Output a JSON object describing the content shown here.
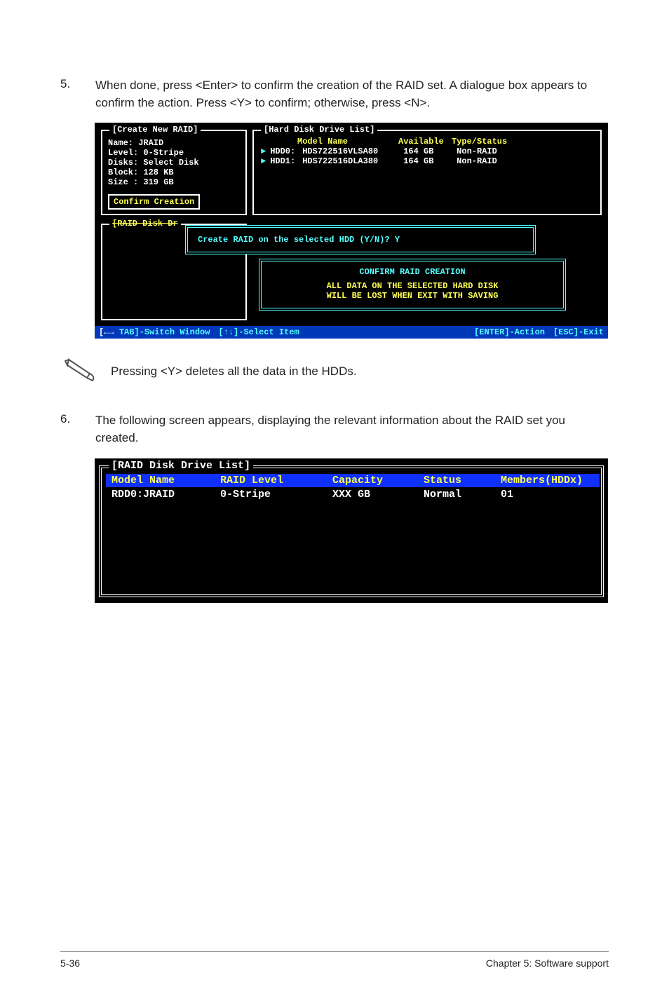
{
  "steps": {
    "5": {
      "num": "5.",
      "text": "When done, press <Enter> to confirm the creation of the RAID set. A dialogue box appears to confirm the action. Press <Y> to confirm; otherwise, press <N>."
    },
    "6": {
      "num": "6.",
      "text": "The following screen appears, displaying the relevant information about the RAID set you created."
    }
  },
  "bios1": {
    "left_title": "[Create New RAID]",
    "fields": {
      "name": "Name:  JRAID",
      "level": "Level: 0-Stripe",
      "disks": "Disks: Select Disk",
      "block": "Block: 128 KB",
      "size": "Size : 319 GB"
    },
    "confirm_btn": "Confirm Creation",
    "right_title": "[Hard Disk Drive List]",
    "hdr": {
      "label": "",
      "model": "Model Name",
      "avail": "Available",
      "type": "Type/Status"
    },
    "rows": [
      {
        "label": "HDD0:",
        "model": "HDS722516VLSA80",
        "avail": "164 GB",
        "type": "Non-RAID"
      },
      {
        "label": "HDD1:",
        "model": "HDS722516DLA380",
        "avail": "164 GB",
        "type": "Non-RAID"
      }
    ],
    "raid_box_title": "[RAID Disk Dr",
    "dialog1": "Create RAID on the selected HDD (Y/N)? Y",
    "dialog2": {
      "l1": "CONFIRM RAID CREATION",
      "l2a": "ALL DATA ON THE SELECTED HARD DISK",
      "l2b": "WILL BE LOST WHEN EXIT WITH SAVING"
    },
    "foot": {
      "a": "TAB]-Switch Window",
      "b": "[↑↓]-Select Item",
      "c": "[ENTER]-Action",
      "d": "[ESC]-Exit"
    }
  },
  "note": "Pressing <Y> deletes all the data in the HDDs.",
  "bios2": {
    "title": "[RAID Disk Drive List]",
    "hdr": {
      "name": "Model Name",
      "level": "RAID Level",
      "cap": "Capacity",
      "stat": "Status",
      "mem": "Members(HDDx)"
    },
    "row": {
      "name": "RDD0:JRAID",
      "level": "0-Stripe",
      "cap": "XXX GB",
      "stat": "Normal",
      "mem": "01"
    }
  },
  "footer": {
    "left": "5-36",
    "right": "Chapter 5: Software support"
  }
}
